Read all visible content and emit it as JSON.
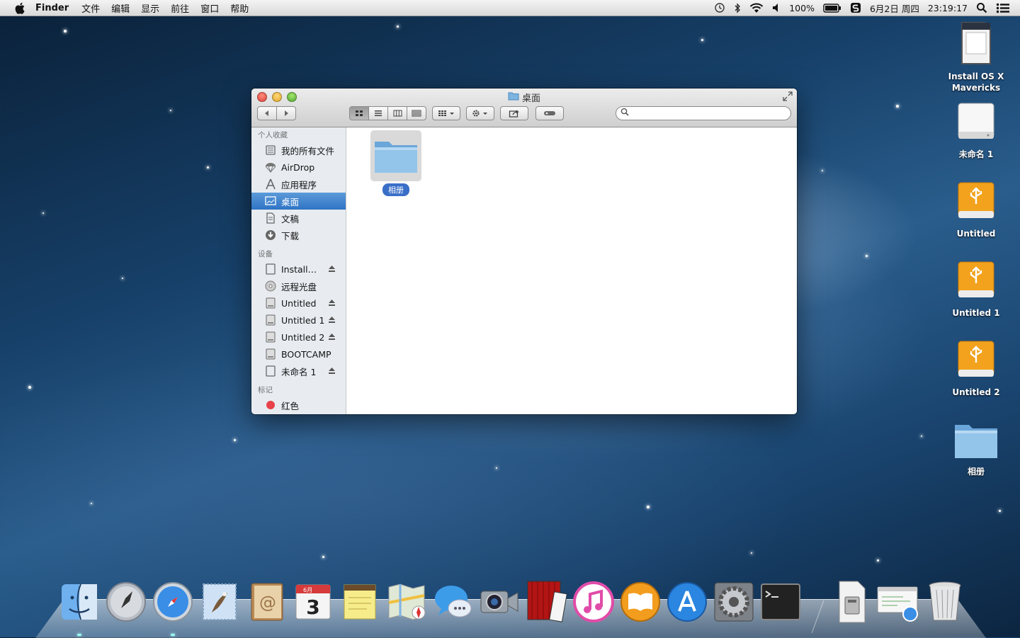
{
  "menubar": {
    "app_name": "Finder",
    "menus": [
      "文件",
      "编辑",
      "显示",
      "前往",
      "窗口",
      "帮助"
    ],
    "battery": "100%",
    "date": "6月2日 周四",
    "time": "23:19:17"
  },
  "window": {
    "title": "桌面",
    "search_placeholder": "",
    "sidebar": {
      "favorites_header": "个人收藏",
      "favorites": [
        {
          "label": "我的所有文件",
          "icon": "all-files-icon"
        },
        {
          "label": "AirDrop",
          "icon": "airdrop-icon"
        },
        {
          "label": "应用程序",
          "icon": "applications-icon"
        },
        {
          "label": "桌面",
          "icon": "desktop-icon",
          "selected": true
        },
        {
          "label": "文稿",
          "icon": "documents-icon"
        },
        {
          "label": "下载",
          "icon": "downloads-icon"
        }
      ],
      "devices_header": "设备",
      "devices": [
        {
          "label": "Install…",
          "icon": "disk-icon",
          "eject": true
        },
        {
          "label": "远程光盘",
          "icon": "optical-disc-icon",
          "eject": false
        },
        {
          "label": "Untitled",
          "icon": "disk-icon",
          "eject": true
        },
        {
          "label": "Untitled 1",
          "icon": "disk-icon",
          "eject": true
        },
        {
          "label": "Untitled 2",
          "icon": "disk-icon",
          "eject": true
        },
        {
          "label": "BOOTCAMP",
          "icon": "disk-icon",
          "eject": false
        },
        {
          "label": "未命名 1",
          "icon": "disk-icon",
          "eject": true
        }
      ],
      "tags_header": "标记",
      "tags": [
        {
          "label": "红色",
          "color": "#e8424a"
        }
      ]
    },
    "items": [
      {
        "label": "相册",
        "icon": "folder-icon"
      }
    ]
  },
  "desktop_icons": [
    {
      "label": "Install OS X\nMavericks",
      "icon": "sd-card-icon"
    },
    {
      "label": "未命名 1",
      "icon": "external-drive-icon"
    },
    {
      "label": "Untitled",
      "icon": "usb-drive-icon"
    },
    {
      "label": "Untitled 1",
      "icon": "usb-drive-icon"
    },
    {
      "label": "Untitled 2",
      "icon": "usb-drive-icon"
    },
    {
      "label": "相册",
      "icon": "folder-icon"
    }
  ],
  "dock": [
    "finder-icon",
    "launchpad-icon",
    "safari-icon",
    "mail-icon",
    "contacts-icon",
    "calendar-icon",
    "notes-icon",
    "maps-icon",
    "messages-icon",
    "facetime-icon",
    "photo-booth-icon",
    "itunes-icon",
    "ibooks-icon",
    "app-store-icon",
    "system-preferences-icon",
    "terminal-icon",
    "disk-utility-icon",
    "network-icon",
    "trash-icon"
  ],
  "calendar_badge": {
    "month": "6月",
    "day": "3"
  },
  "colors": {
    "selection": "#3a78c8",
    "usb_drive": "#f2a21c",
    "folder": "#8cc0e8"
  }
}
